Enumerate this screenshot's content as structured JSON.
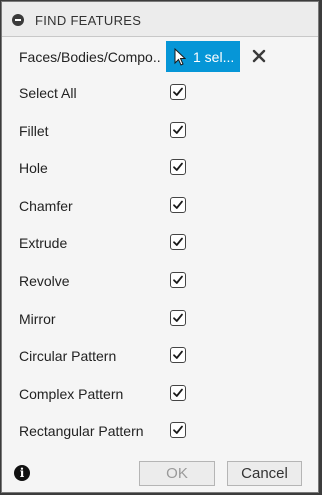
{
  "header": {
    "title": "FIND FEATURES"
  },
  "selection": {
    "label": "Faces/Bodies/Compo...",
    "button_label": "1 sel..."
  },
  "options": [
    {
      "label": "Select All",
      "checked": true
    },
    {
      "label": "Fillet",
      "checked": true
    },
    {
      "label": "Hole",
      "checked": true
    },
    {
      "label": "Chamfer",
      "checked": true
    },
    {
      "label": "Extrude",
      "checked": true
    },
    {
      "label": "Revolve",
      "checked": true
    },
    {
      "label": "Mirror",
      "checked": true
    },
    {
      "label": "Circular Pattern",
      "checked": true
    },
    {
      "label": "Complex Pattern",
      "checked": true
    },
    {
      "label": "Rectangular Pattern",
      "checked": true
    }
  ],
  "footer": {
    "info_icon": "i",
    "ok_label": "OK",
    "cancel_label": "Cancel"
  },
  "colors": {
    "accent": "#0696d7",
    "panel": "#f5f5f5",
    "frame": "#3c3c3c"
  }
}
